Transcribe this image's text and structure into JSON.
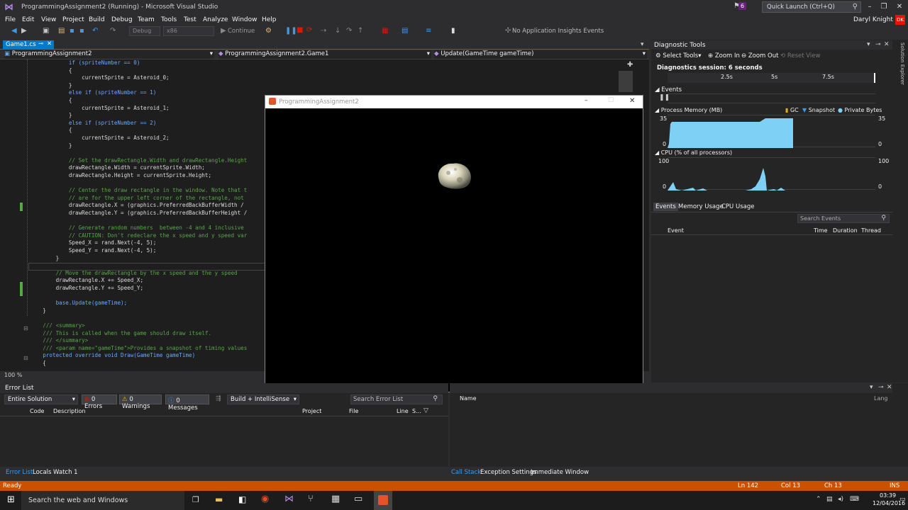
{
  "app": {
    "window_title": "ProgrammingAssignment2 (Running) - Microsoft Visual Studio",
    "notif_count": "6",
    "quick_launch_placeholder": "Quick Launch (Ctrl+Q)",
    "user_name": "Daryl Knight",
    "user_initials": "DK"
  },
  "menu": [
    "File",
    "Edit",
    "View",
    "Project",
    "Build",
    "Debug",
    "Team",
    "Tools",
    "Test",
    "Analyze",
    "Window",
    "Help"
  ],
  "toolbar": {
    "config": "Debug",
    "platform": "x86",
    "continue_label": "Continue",
    "insights_label": "No Application Insights Events"
  },
  "editor": {
    "tab_label": "Game1.cs",
    "project_combo": "ProgrammingAssignment2",
    "class_combo": "ProgrammingAssignment2.Game1",
    "member_combo": "Update(GameTime gameTime)",
    "zoom": "100 %",
    "lines": [
      "            if (spriteNumber == 0)",
      "            {",
      "                currentSprite = Asteroid_0;",
      "            }",
      "            else if (spriteNumber == 1)",
      "            {",
      "                currentSprite = Asteroid_1;",
      "            }",
      "            else if (spriteNumber == 2)",
      "            {",
      "                currentSprite = Asteroid_2;",
      "            }",
      "",
      "            // Set the drawRectangle.Width and drawRectangle.Height",
      "            drawRectangle.Width = currentSprite.Width;",
      "            drawRectangle.Height = currentSprite.Height;",
      "",
      "            // Center the draw rectangle in the window. Note that t",
      "            // are for the upper left corner of the rectangle, not",
      "            drawRectangle.X = (graphics.PreferredBackBufferWidth /",
      "            drawRectangle.Y = (graphics.PreferredBackBufferHeight /",
      "",
      "            // Generate random numbers  between -4 and 4 inclusive",
      "            // CAUTION: Don't redeclare the x speed and y speed var",
      "            Speed_X = rand.Next(-4, 5);",
      "            Speed_Y = rand.Next(-4, 5);",
      "        }",
      "",
      "        // Move the drawRectangle by the x speed and the y speed",
      "        drawRectangle.X += Speed_X;",
      "        drawRectangle.Y += Speed_Y;",
      "",
      "        base.Update(gameTime);",
      "    }",
      "",
      "    /// <summary>",
      "    /// This is called when the game should draw itself.",
      "    /// </summary>",
      "    /// <param name=\"gameTime\">Provides a snapshot of timing values",
      "    protected override void Draw(GameTime gameTime)",
      "    {"
    ]
  },
  "diagnostics": {
    "title": "Diagnostic Tools",
    "select_tools": "Select Tools",
    "zoom_in": "Zoom In",
    "zoom_out": "Zoom Out",
    "reset_view": "Reset View",
    "session": "Diagnostics session: 6 seconds",
    "timeline_ticks": [
      "2.5s",
      "5s",
      "7.5s"
    ],
    "events_label": "Events",
    "memory_label": "Process Memory (MB)",
    "gc_label": "GC",
    "snapshot_label": "Snapshot",
    "private_bytes_label": "Private Bytes",
    "mem_max": "35",
    "mem_min": "0",
    "cpu_label": "CPU (% of all processors)",
    "cpu_max": "100",
    "cpu_min": "0",
    "tabs": [
      "Events",
      "Memory Usage",
      "CPU Usage"
    ],
    "search_placeholder": "Search Events",
    "columns": [
      "Event",
      "Time",
      "Duration",
      "Thread"
    ]
  },
  "game_window": {
    "title": "ProgrammingAssignment2"
  },
  "error_list": {
    "title": "Error List",
    "scope": "Entire Solution",
    "errors": "0 Errors",
    "warnings": "0 Warnings",
    "messages": "0 Messages",
    "build_filter": "Build + IntelliSense",
    "search_placeholder": "Search Error List",
    "columns": [
      "Code",
      "Description",
      "Project",
      "File",
      "Line",
      "S..."
    ],
    "bottom_tabs": [
      "Error List",
      "Locals",
      "Watch 1"
    ]
  },
  "call_stack": {
    "columns": [
      "Name",
      "Lang"
    ],
    "bottom_tabs": [
      "Call Stack",
      "Exception Settings",
      "Immediate Window"
    ]
  },
  "statusbar": {
    "status": "Ready",
    "ln": "Ln 142",
    "col": "Col 13",
    "ch": "Ch 13",
    "ins": "INS"
  },
  "taskbar": {
    "search": "Search the web and Windows",
    "time": "03:39",
    "date": "12/04/2016"
  }
}
